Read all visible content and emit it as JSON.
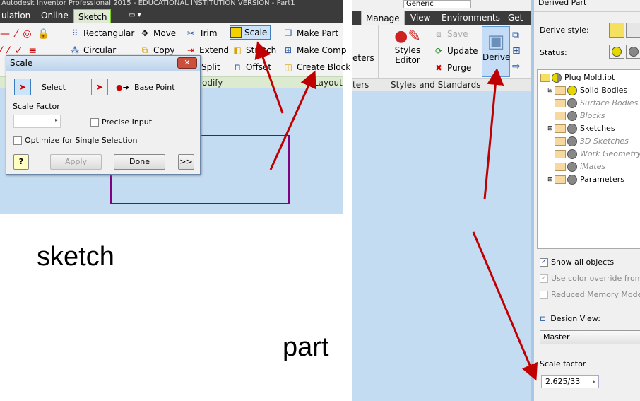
{
  "left": {
    "window_title": "Autodesk Inventor Professional 2015 - EDUCATIONAL INSTITUTION VERSION - Part1",
    "tabs": [
      {
        "label": "ulation"
      },
      {
        "label": "Online"
      },
      {
        "label": "Sketch",
        "active": true
      }
    ],
    "ribbon": {
      "pattern": [
        "Rectangular",
        "Circular"
      ],
      "modify": [
        "Move",
        "Copy",
        "Trim",
        "Extend",
        "Split",
        "Scale",
        "Stretch",
        "Offset"
      ],
      "layout": [
        "Make Part",
        "Make Comp",
        "Create Block"
      ],
      "panel_labels": {
        "modify": "odify",
        "layout": "Layout"
      }
    },
    "scale_dialog": {
      "title": "Scale",
      "select": "Select",
      "base_point": "Base Point",
      "scale_factor_label": "Scale Factor",
      "scale_factor_value": "",
      "precise_input": "Precise Input",
      "optimize": "Optimize for Single Selection",
      "apply": "Apply",
      "done": "Done",
      "more": ">>",
      "help": "?"
    },
    "caption": "sketch"
  },
  "right": {
    "style_field": "Generic",
    "tabs": [
      {
        "label": "Manage",
        "active": true
      },
      {
        "label": "View"
      },
      {
        "label": "Environments"
      },
      {
        "label": "Get S"
      }
    ],
    "ribbon": {
      "parameters": "eters",
      "parameters_panel": "ters",
      "styles_editor": "Styles Editor",
      "save": "Save",
      "update": "Update",
      "purge": "Purge",
      "styles_panel": "Styles and Standards",
      "derive": "Derive"
    },
    "derived_part": {
      "title": "Derived Part",
      "derive_style": "Derive style:",
      "status": "Status:",
      "tree": [
        {
          "label": "Plug Mold.ipt",
          "root": true
        },
        {
          "label": "Solid Bodies",
          "expand": true,
          "included": true
        },
        {
          "label": "Surface Bodies",
          "disabled": true
        },
        {
          "label": "Blocks",
          "disabled": true
        },
        {
          "label": "Sketches",
          "expand": true
        },
        {
          "label": "3D Sketches",
          "disabled": true
        },
        {
          "label": "Work Geometry",
          "disabled": true
        },
        {
          "label": "iMates",
          "disabled": true
        },
        {
          "label": "Parameters",
          "expand": true
        }
      ],
      "show_all": "Show all objects",
      "show_all_checked": true,
      "color_override": "Use color override from s",
      "color_override_checked": true,
      "reduced_memory": "Reduced Memory Mode",
      "reduced_memory_checked": false,
      "design_view_label": "Design View:",
      "design_view_value": "Master",
      "scale_factor_label": "Scale factor",
      "scale_factor_value": "2.625/33"
    },
    "caption": "part"
  },
  "colors": {
    "arrow": "#c00000",
    "sketch_line": "#800080",
    "canvas": "#c4dcf2"
  }
}
